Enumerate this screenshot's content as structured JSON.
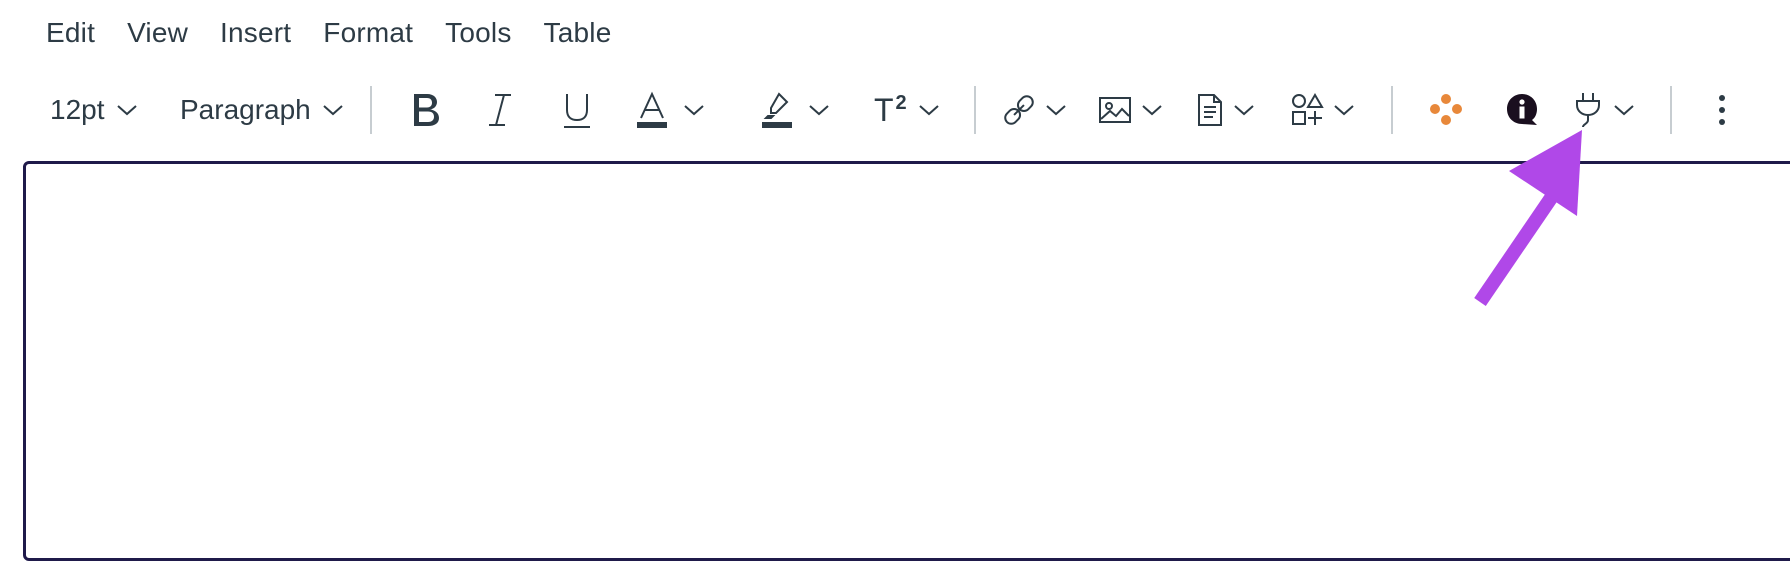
{
  "menubar": {
    "items": [
      "Edit",
      "View",
      "Insert",
      "Format",
      "Tools",
      "Table"
    ]
  },
  "toolbar": {
    "font_size": "12pt",
    "block_format": "Paragraph",
    "superscript_label": "T",
    "superscript_mark": "2",
    "icons": {
      "bold": "bold-icon",
      "italic": "italic-icon",
      "underline": "underline-icon",
      "text_color": "text-color-icon",
      "highlight": "highlight-icon",
      "superscript": "superscript-icon",
      "link": "link-icon",
      "image": "image-icon",
      "document": "document-icon",
      "embed": "shapes-icon",
      "app": "orange-dots-icon",
      "info": "info-bubble-icon",
      "plugin": "plug-icon",
      "more": "kebab-menu-icon"
    }
  },
  "colors": {
    "text": "#2d3b45",
    "editor_border": "#1f1a4a",
    "arrow": "#b048e8",
    "app_icon": "#e8883a",
    "info_icon": "#1a0f1f"
  }
}
